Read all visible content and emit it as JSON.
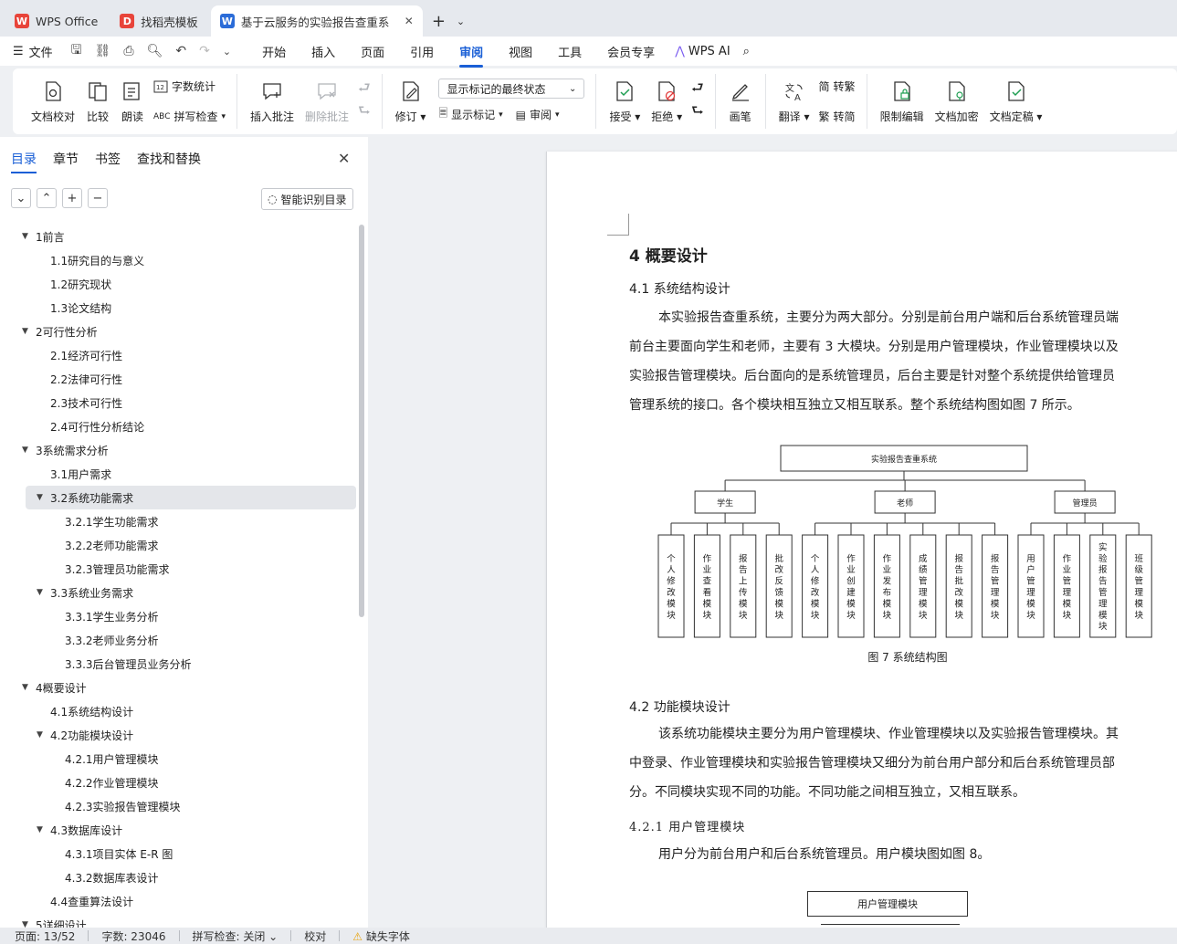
{
  "tabs": [
    {
      "label": "WPS Office",
      "logo": "W",
      "color": "#e8443a"
    },
    {
      "label": "找稻壳模板",
      "logo": "D",
      "color": "#e8443a"
    },
    {
      "label": "基于云服务的实验报告查重系",
      "logo": "W",
      "color": "#2b6cd8"
    }
  ],
  "menu": {
    "file": "文件",
    "items": [
      "开始",
      "插入",
      "页面",
      "引用",
      "审阅",
      "视图",
      "工具",
      "会员专享"
    ],
    "active": "审阅",
    "ai": "WPS AI"
  },
  "ribbon": {
    "doc_check": "文档校对",
    "compare": "比较",
    "read_aloud": "朗读",
    "word_count": "字数统计",
    "spell_check": "拼写检查",
    "insert_comment": "插入批注",
    "delete_comment": "删除批注",
    "revise": "修订",
    "markup_dropdown": "显示标记的最终状态",
    "show_markup": "显示标记",
    "review": "审阅",
    "accept": "接受",
    "reject": "拒绝",
    "pen": "画笔",
    "translate": "翻译",
    "to_traditional": "转繁",
    "to_simplified": "转简",
    "restrict_edit": "限制编辑",
    "encrypt": "文档加密",
    "finalize": "文档定稿"
  },
  "panel": {
    "tabs": [
      "目录",
      "章节",
      "书签",
      "查找和替换"
    ],
    "smart_toc": "智能识别目录",
    "toc": [
      {
        "t": "1前言",
        "lv": 1
      },
      {
        "t": "1.1研究目的与意义",
        "lv": 2
      },
      {
        "t": "1.2研究现状",
        "lv": 2
      },
      {
        "t": "1.3论文结构",
        "lv": 2
      },
      {
        "t": "2可行性分析",
        "lv": 1
      },
      {
        "t": "2.1经济可行性",
        "lv": 2
      },
      {
        "t": "2.2法律可行性",
        "lv": 2
      },
      {
        "t": "2.3技术可行性",
        "lv": 2
      },
      {
        "t": "2.4可行性分析结论",
        "lv": 2
      },
      {
        "t": "3系统需求分析",
        "lv": 1
      },
      {
        "t": "3.1用户需求",
        "lv": 2
      },
      {
        "t": "3.2系统功能需求",
        "lv": 2,
        "exp": true,
        "sel": true
      },
      {
        "t": "3.2.1学生功能需求",
        "lv": 3
      },
      {
        "t": "3.2.2老师功能需求",
        "lv": 3
      },
      {
        "t": "3.2.3管理员功能需求",
        "lv": 3
      },
      {
        "t": "3.3系统业务需求",
        "lv": 2,
        "exp": true
      },
      {
        "t": "3.3.1学生业务分析",
        "lv": 3
      },
      {
        "t": "3.3.2老师业务分析",
        "lv": 3
      },
      {
        "t": "3.3.3后台管理员业务分析",
        "lv": 3
      },
      {
        "t": "4概要设计",
        "lv": 1
      },
      {
        "t": "4.1系统结构设计",
        "lv": 2
      },
      {
        "t": "4.2功能模块设计",
        "lv": 2,
        "exp": true
      },
      {
        "t": "4.2.1用户管理模块",
        "lv": 3
      },
      {
        "t": "4.2.2作业管理模块",
        "lv": 3
      },
      {
        "t": "4.2.3实验报告管理模块",
        "lv": 3
      },
      {
        "t": "4.3数据库设计",
        "lv": 2,
        "exp": true
      },
      {
        "t": "4.3.1项目实体 E-R 图",
        "lv": 3
      },
      {
        "t": "4.3.2数据库表设计",
        "lv": 3
      },
      {
        "t": "4.4查重算法设计",
        "lv": 2
      },
      {
        "t": "5详细设计",
        "lv": 1
      }
    ]
  },
  "doc": {
    "h1": "4 概要设计",
    "h2_1": "4.1 系统结构设计",
    "para1": [
      "本实验报告查重系统，主要分为两大部分。分别是前台用户端和后台系统管理员端",
      "前台主要面向学生和老师，主要有 3 大模块。分别是用户管理模块，作业管理模块以及",
      "实验报告管理模块。后台面向的是系统管理员，后台主要是针对整个系统提供给管理员",
      "管理系统的接口。各个模块相互独立又相互联系。整个系统结构图如图 7 所示。"
    ],
    "diagram": {
      "root": "实验报告查重系统",
      "groups": [
        {
          "name": "学生",
          "children": [
            "个人修改模块",
            "作业查看模块",
            "报告上传模块",
            "批改反馈模块"
          ]
        },
        {
          "name": "老师",
          "children": [
            "个人修改模块",
            "作业创建模块",
            "作业发布模块",
            "成绩管理模块",
            "报告批改模块",
            "报告管理模块"
          ]
        },
        {
          "name": "管理员",
          "children": [
            "用户管理模块",
            "作业管理模块",
            "实验报告管理模块",
            "班级管理模块"
          ]
        }
      ]
    },
    "caption": "图 7 系统结构图",
    "h2_2": "4.2 功能模块设计",
    "para2": [
      "该系统功能模块主要分为用户管理模块、作业管理模块以及实验报告管理模块。其",
      "中登录、作业管理模块和实验报告管理模块又细分为前台用户部分和后台系统管理员部",
      "分。不同模块实现不同的功能。不同功能之间相互独立，又相互联系。"
    ],
    "h3_1": "4.2.1 用户管理模块",
    "para3": "用户分为前台用户和后台系统管理员。用户模块图如图 8。",
    "diagram2_root": "用户管理模块"
  },
  "status": {
    "page": "页面: 13/52",
    "words": "字数: 23046",
    "spell": "拼写检查: 关闭",
    "proof": "校对",
    "missing_font": "缺失字体"
  }
}
